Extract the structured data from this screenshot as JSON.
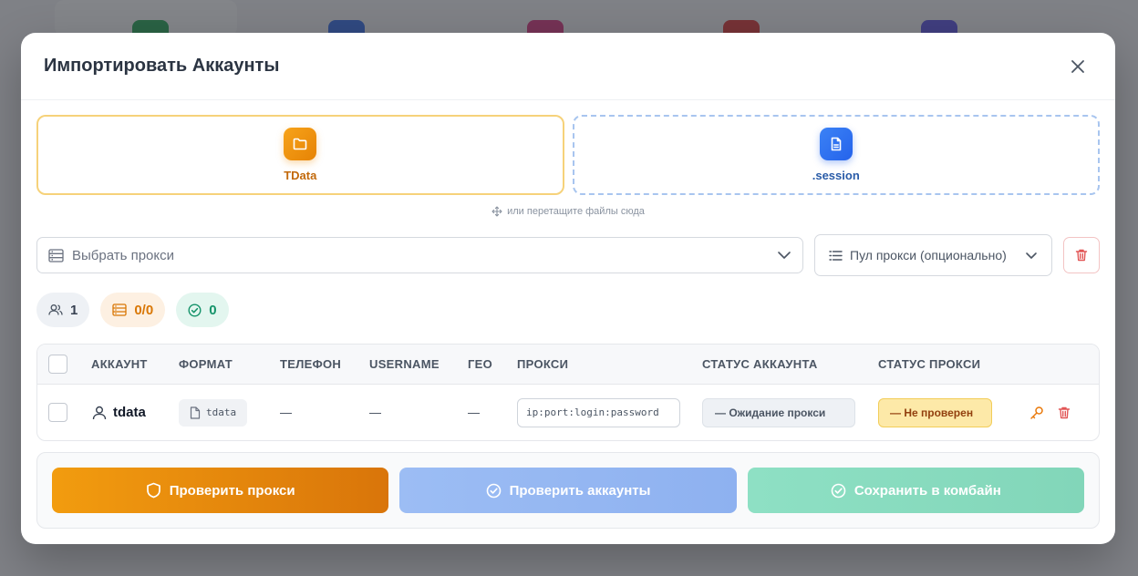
{
  "modal": {
    "title": "Импортировать Аккаунты"
  },
  "upload": {
    "tdata_label": "TData",
    "session_label": ".session",
    "drop_hint": "или перетащите файлы сюда"
  },
  "proxy": {
    "select_placeholder": "Выбрать прокси",
    "pool_placeholder": "Пул прокси (опционально)"
  },
  "stats": {
    "accounts": "1",
    "proxies": "0/0",
    "valid": "0"
  },
  "table": {
    "headers": [
      "АККАУНТ",
      "ФОРМАТ",
      "ТЕЛЕФОН",
      "USERNAME",
      "ГЕО",
      "ПРОКСИ",
      "СТАТУС АККАУНТА",
      "СТАТУС ПРОКСИ"
    ],
    "rows": [
      {
        "account": "tdata",
        "format": "tdata",
        "phone": "—",
        "username": "—",
        "geo": "—",
        "proxy_placeholder": "ip:port:login:password",
        "account_status": "— Ожидание прокси",
        "proxy_status": "— Не проверен"
      }
    ]
  },
  "actions": {
    "check_proxy": "Проверить прокси",
    "check_accounts": "Проверить аккаунты",
    "save_combine": "Сохранить в комбайн"
  },
  "colors": {
    "accent_orange": "#f29c0f",
    "accent_blue": "#2563eb",
    "accent_green": "#15936a",
    "danger": "#e25555"
  }
}
